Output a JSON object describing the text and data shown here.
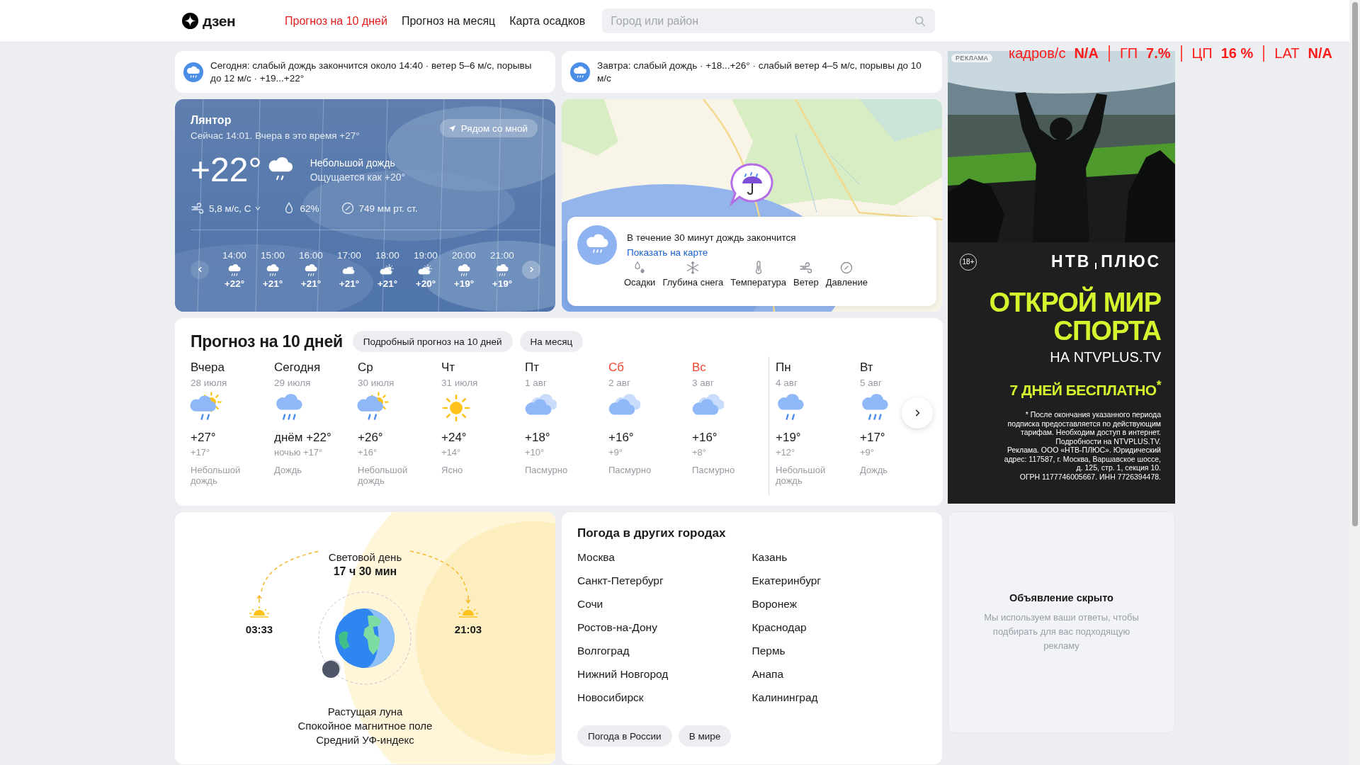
{
  "header": {
    "logo": "дзен",
    "nav": [
      {
        "label": "Прогноз на 10 дней",
        "selected": true
      },
      {
        "label": "Прогноз на месяц",
        "selected": false
      },
      {
        "label": "Карта осадков",
        "selected": false
      }
    ],
    "search": {
      "placeholder": "Город или район"
    }
  },
  "alerts": [
    {
      "text": "Сегодня: слабый дождь закончится около 14:40 · ветер 5–6 м/с, порывы до 12 м/с · +19...+22°"
    },
    {
      "text": "Завтра: слабый дождь · +18...+26° · слабый ветер 4–5 м/с, порывы до 10 м/с"
    }
  ],
  "current": {
    "city": "Лянтор",
    "subtitle": "Сейчас 14:01. Вчера в это время +27°",
    "near_button": "Рядом со мной",
    "temperature": "+22°",
    "condition": "Небольшой дождь",
    "feels_like": "Ощущается как +20°",
    "wind": "5,8 м/с, С",
    "humidity": "62%",
    "pressure": "749 мм рт. ст.",
    "hourly": [
      {
        "time": "14:00",
        "temp": "+22°",
        "kind": "rain"
      },
      {
        "time": "15:00",
        "temp": "+21°",
        "kind": "rain"
      },
      {
        "time": "16:00",
        "temp": "+21°",
        "kind": "rain"
      },
      {
        "time": "17:00",
        "temp": "+21°",
        "kind": "cloudy_sun"
      },
      {
        "time": "18:00",
        "temp": "+21°",
        "kind": "partly_sunny"
      },
      {
        "time": "19:00",
        "temp": "+20°",
        "kind": "partly_sunny"
      },
      {
        "time": "20:00",
        "temp": "+19°",
        "kind": "rain"
      },
      {
        "time": "21:00",
        "temp": "+19°",
        "kind": "rain"
      }
    ]
  },
  "map": {
    "nowcast": "В течение 30 минут дождь закончится",
    "link": "Показать на карте",
    "layers": [
      {
        "label": "Осадки",
        "kind": "precipitation"
      },
      {
        "label": "Глубина снега",
        "kind": "snow"
      },
      {
        "label": "Температура",
        "kind": "temperature"
      },
      {
        "label": "Ветер",
        "kind": "wind"
      },
      {
        "label": "Давление",
        "kind": "pressure"
      }
    ]
  },
  "forecast": {
    "title": "Прогноз на 10 дней",
    "buttons": [
      "Подробный прогноз на 10 дней",
      "На месяц"
    ],
    "days": [
      {
        "day": "Вчера",
        "date": "28 июля",
        "kind": "sun_rain",
        "temp": "+27°",
        "night": "+17°",
        "condition": "Небольшой дождь",
        "weekend": false,
        "week_start": false
      },
      {
        "day": "Сегодня",
        "date": "29 июля",
        "kind": "rain",
        "temp": "днём +22°",
        "night": "ночью +17°",
        "condition": "Дождь",
        "weekend": false,
        "week_start": false
      },
      {
        "day": "Ср",
        "date": "30 июля",
        "kind": "sun_rain",
        "temp": "+26°",
        "night": "+16°",
        "condition": "Небольшой дождь",
        "weekend": false,
        "week_start": false
      },
      {
        "day": "Чт",
        "date": "31 июля",
        "kind": "sun",
        "temp": "+24°",
        "night": "+14°",
        "condition": "Ясно",
        "weekend": false,
        "week_start": false
      },
      {
        "day": "Пт",
        "date": "1 авг",
        "kind": "overcast",
        "temp": "+18°",
        "night": "+10°",
        "condition": "Пасмурно",
        "weekend": false,
        "week_start": false
      },
      {
        "day": "Сб",
        "date": "2 авг",
        "kind": "overcast",
        "temp": "+16°",
        "night": "+9°",
        "condition": "Пасмурно",
        "weekend": true,
        "week_start": false
      },
      {
        "day": "Вс",
        "date": "3 авг",
        "kind": "overcast",
        "temp": "+16°",
        "night": "+8°",
        "condition": "Пасмурно",
        "weekend": true,
        "week_start": false
      },
      {
        "day": "Пн",
        "date": "4 авг",
        "kind": "light_rain",
        "temp": "+19°",
        "night": "+12°",
        "condition": "Небольшой дождь",
        "weekend": false,
        "week_start": true
      },
      {
        "day": "Вт",
        "date": "5 авг",
        "kind": "rain",
        "temp": "+17°",
        "night": "+9°",
        "condition": "Дождь",
        "weekend": false,
        "week_start": false
      }
    ]
  },
  "sun": {
    "daylight_label": "Световой день",
    "daylight": "17 ч 30 мин",
    "sunrise": "03:33",
    "sunset": "21:03",
    "moon": "Растущая луна",
    "magnetic": "Спокойное магнитное поле",
    "uv": "Средний УФ-индекс"
  },
  "cities": {
    "title": "Погода в других городах",
    "columns": [
      [
        "Москва",
        "Санкт-Петербург",
        "Сочи",
        "Ростов-на-Дону",
        "Волгоград",
        "Нижний Новгород",
        "Новосибирск"
      ],
      [
        "Казань",
        "Екатеринбург",
        "Воронеж",
        "Краснодар",
        "Пермь",
        "Анапа",
        "Калининград"
      ]
    ],
    "buttons": [
      "Погода в России",
      "В мире"
    ]
  },
  "ad": {
    "label": "РЕКЛАМА",
    "age": "18+",
    "brand": [
      "НТВ",
      "ПЛЮС"
    ],
    "headline": [
      "ОТКРОЙ МИР",
      "СПОРТА"
    ],
    "site": "НА NTVPLUS.TV",
    "offer": "7 ДНЕЙ БЕСПЛАТНО$^{*}$",
    "fine_print": [
      "* После окончания указанного периода",
      "подписка предоставляется по действующим",
      "тарифам. Необходим доступ в интернет.",
      "Подробности на NTVPLUS.TV.",
      "Реклама. ООО «НТВ-ПЛЮС». Юридический",
      "адрес: 117587, г. Москва, Варшавское шоссе,",
      "д. 125, стр. 1, секция 10.",
      "ОГРН 1177746005667. ИНН 7726394478."
    ]
  },
  "hidden_ad": {
    "title": "Объявление скрыто",
    "text": "Мы используем ваши ответы, чтобы подбирать для вас подходящую рекламу"
  },
  "overlay": [
    {
      "label": "кадров/с",
      "value": "N/A"
    },
    {
      "label": "ГП",
      "value": "7.%"
    },
    {
      "label": "ЦП",
      "value": "16 %"
    },
    {
      "label": "LAT",
      "value": "N/A"
    }
  ]
}
